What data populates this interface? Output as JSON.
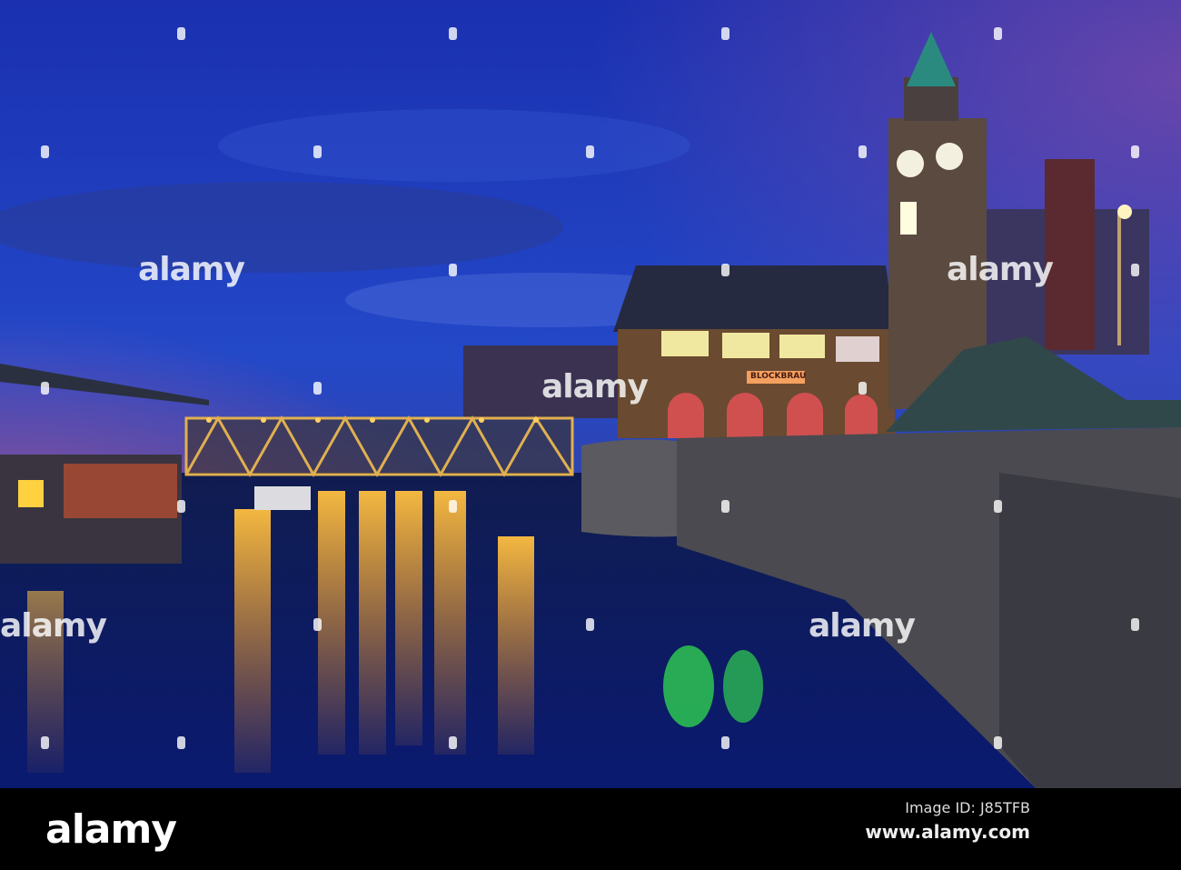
{
  "photo": {
    "description_sign": "BLOCKBRAU",
    "watermark": "alamy"
  },
  "footer": {
    "logo": "alamy",
    "image_id": "Image ID: J85TFB",
    "website": "www.alamy.com"
  },
  "colors": {
    "sky_top": "#1a2fa8",
    "sky_mid": "#2446c8",
    "horizon_pink": "#c0507a",
    "water": "#0c1a5a",
    "light": "#ffb830"
  }
}
